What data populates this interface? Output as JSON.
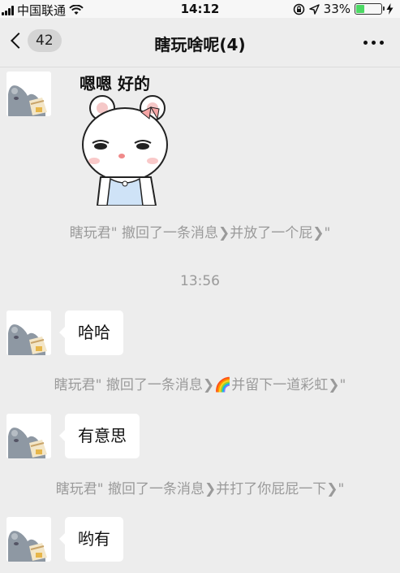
{
  "status_bar": {
    "carrier": "中国联通",
    "time": "14:12",
    "battery_percent": "33%",
    "battery_level": 0.33,
    "icons": [
      "signal-icon",
      "wifi-icon",
      "orientation-lock-icon",
      "location-icon",
      "battery-icon",
      "charging-icon"
    ]
  },
  "nav": {
    "unread_count": "42",
    "title": "瞎玩啥呢(4)"
  },
  "messages": {
    "sticker_text": "嗯嗯 好的",
    "system_1": "瞎玩君\" 撤回了一条消息❯并放了一个屁❯\"",
    "timestamp": "13:56",
    "bubble_1": "哈哈",
    "system_2": "瞎玩君\" 撤回了一条消息❯🌈并留下一道彩虹❯\"",
    "bubble_2": "有意思",
    "system_3": "瞎玩君\" 撤回了一条消息❯并打了你屁屁一下❯\"",
    "bubble_3": "哟有"
  },
  "colors": {
    "background": "#ededed",
    "bubble": "#ffffff",
    "system_text": "#9a9a9a",
    "battery": "#4cd964"
  }
}
